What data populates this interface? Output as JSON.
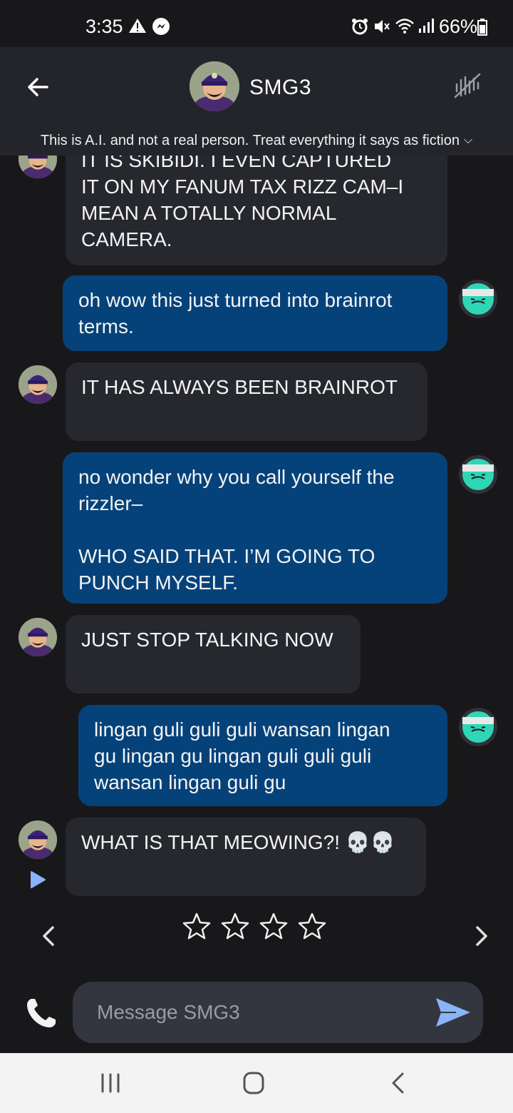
{
  "status_bar": {
    "time": "3:35",
    "battery": "66%",
    "icons": [
      "warning-icon",
      "messenger-icon",
      "alarm-icon",
      "mute-icon",
      "wifi-icon",
      "signal-icon",
      "battery-icon"
    ]
  },
  "header": {
    "title": "SMG3",
    "disclaimer": "This is A.I. and not a real person. Treat everything it says as fiction",
    "back_icon": "arrow-left-icon",
    "mute_icon": "voice-off-icon"
  },
  "messages": [
    {
      "sender": "bot",
      "text": "IT IS SKIBIDI. I EVEN CAPTURED\nIT ON MY FANUM TAX RIZZ CAM–I\nMEAN A TOTALLY NORMAL\nCAMERA."
    },
    {
      "sender": "user",
      "text": "oh wow this just turned into brainrot\nterms."
    },
    {
      "sender": "bot",
      "text": "IT HAS ALWAYS BEEN BRAINROT"
    },
    {
      "sender": "user",
      "text": "no wonder why you call yourself the\nrizzler–\n\nWHO SAID THAT. I’M GOING TO\nPUNCH MYSELF."
    },
    {
      "sender": "bot",
      "text": "JUST STOP TALKING NOW"
    },
    {
      "sender": "user",
      "text": "lingan guli guli guli wansan lingan\ngu lingan gu lingan guli guli guli\nwansan lingan guli gu"
    },
    {
      "sender": "bot",
      "text": "WHAT IS THAT MEOWING?! 💀💀"
    }
  ],
  "rating": {
    "stars": 4,
    "filled": 0
  },
  "composer": {
    "placeholder": "Message SMG3"
  },
  "colors": {
    "background": "#18181b",
    "header": "#23252b",
    "bot_bubble": "#26282e",
    "user_bubble": "#06427a",
    "send_accent": "#8ab4f8"
  }
}
